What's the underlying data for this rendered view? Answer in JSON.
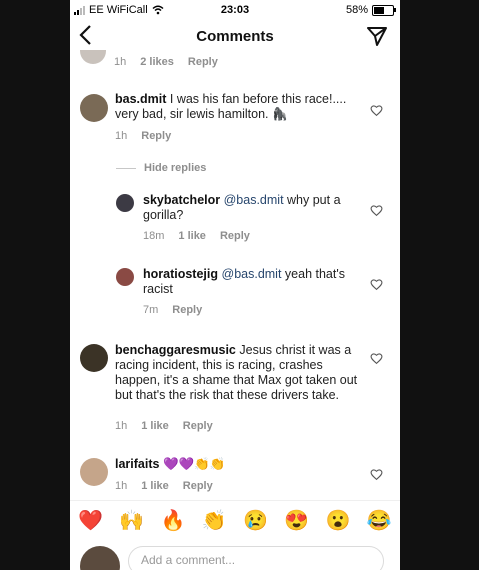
{
  "status_bar": {
    "carrier": "EE WiFiCall",
    "time": "23:03",
    "battery": "58%",
    "battery_level": 0.58
  },
  "header": {
    "title": "Comments",
    "back_icon": "chevron-left-icon",
    "send_icon": "send-icon"
  },
  "top_meta": {
    "time": "1h",
    "likes": "2 likes",
    "reply": "Reply"
  },
  "comments": [
    {
      "username": "bas.dmit",
      "text": " I was his fan before this race!.... very bad, sir lewis hamilton. 🦍",
      "time": "1h",
      "likes": "",
      "reply": "Reply"
    },
    {
      "username": "skybatchelor",
      "mention": "@bas.dmit",
      "text": " why put a gorilla?",
      "time": "18m",
      "likes": "1 like",
      "reply": "Reply"
    },
    {
      "username": "horatiostejig",
      "mention": "@bas.dmit",
      "text": " yeah that's racist",
      "time": "7m",
      "likes": "",
      "reply": "Reply"
    },
    {
      "username": "benchaggaresmusic",
      "text": " Jesus christ it was a racing incident, this is racing, crashes happen, it's a shame that Max got taken out but that's the risk that these drivers take.",
      "time": "1h",
      "likes": "1 like",
      "reply": "Reply"
    },
    {
      "username": "larifaits",
      "text": " 💜💜👏👏",
      "time": "1h",
      "likes": "1 like",
      "reply": "Reply"
    }
  ],
  "hide_replies": "Hide replies",
  "emoji_bar": [
    "❤️",
    "🙌",
    "🔥",
    "👏",
    "😢",
    "😍",
    "😮",
    "😂"
  ],
  "compose": {
    "placeholder": "Add a comment..."
  }
}
